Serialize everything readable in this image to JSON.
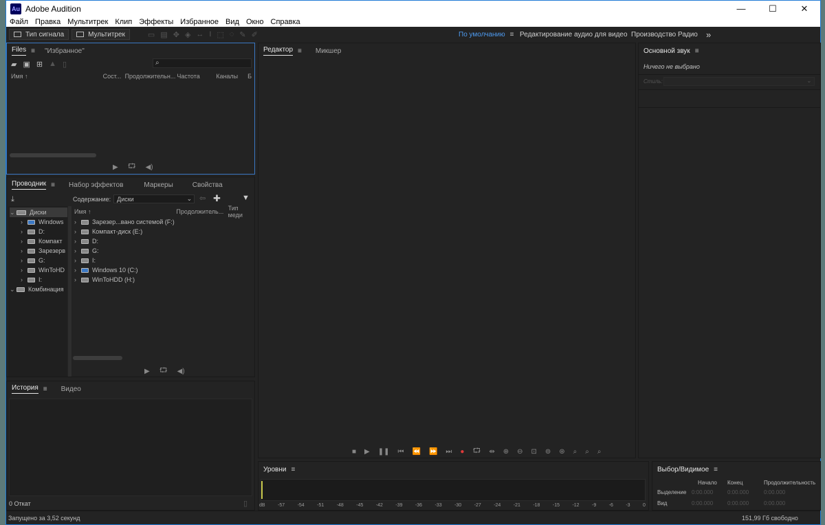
{
  "window": {
    "title": "Adobe Audition",
    "app_icon_text": "Au",
    "minimize": "—",
    "maximize": "☐",
    "close": "✕"
  },
  "menu": [
    "Файл",
    "Правка",
    "Мультитрек",
    "Клип",
    "Эффекты",
    "Избранное",
    "Вид",
    "Окно",
    "Справка"
  ],
  "toolbar": {
    "waveform_label": "Тип сигнала",
    "multitrack_label": "Мультитрек"
  },
  "workspaces": {
    "default": "По умолчанию",
    "video": "Редактирование аудио для видео",
    "radio": "Производство Радио",
    "more": "»"
  },
  "files_panel": {
    "tab_files": "Files",
    "tab_favorites": "\"Избранное\"",
    "search_icon": "⌕",
    "columns": [
      "Имя ↑",
      "Сост...",
      "Продолжительн...",
      "Частота",
      "Каналы",
      "Б"
    ]
  },
  "explorer_panel": {
    "tabs": [
      "Проводник",
      "Набор эффектов",
      "Маркеры",
      "Свойства"
    ],
    "content_label": "Содержание:",
    "content_value": "Диски",
    "tree": [
      {
        "label": "Диски",
        "chev": "⌄",
        "indent": 0
      },
      {
        "label": "Windows",
        "chev": "›",
        "indent": 1
      },
      {
        "label": "D:",
        "chev": "›",
        "indent": 1
      },
      {
        "label": "Компакт",
        "chev": "›",
        "indent": 1
      },
      {
        "label": "Зарезерв",
        "chev": "›",
        "indent": 1
      },
      {
        "label": "G:",
        "chev": "›",
        "indent": 1
      },
      {
        "label": "WinToHD",
        "chev": "›",
        "indent": 1
      },
      {
        "label": "I:",
        "chev": "›",
        "indent": 1
      },
      {
        "label": "Комбинация",
        "chev": "⌄",
        "indent": 0
      }
    ],
    "list_columns": [
      "Имя ↑",
      "Продолжитель...",
      "Тип меди"
    ],
    "list": [
      "Зарезер...вано системой (F:)",
      "Компакт-диск (E:)",
      "D:",
      "G:",
      "I:",
      "Windows 10 (C:)",
      "WinToHDD (H:)"
    ]
  },
  "history_panel": {
    "tabs": [
      "История",
      "Видео"
    ],
    "undo_count": "0 Откат"
  },
  "editor_panel": {
    "tabs": [
      "Редактор",
      "Микшер"
    ]
  },
  "essential_sound": {
    "tab": "Основной звук",
    "nothing_selected": "Ничего не выбрано",
    "style_label": "Стиль:"
  },
  "levels_panel": {
    "tab": "Уровни",
    "scale": [
      "dB",
      "-57",
      "-54",
      "-51",
      "-48",
      "-45",
      "-42",
      "-39",
      "-36",
      "-33",
      "-30",
      "-27",
      "-24",
      "-21",
      "-18",
      "-15",
      "-12",
      "-9",
      "-6",
      "-3",
      "0"
    ]
  },
  "selection_panel": {
    "tab": "Выбор/Видимое",
    "headers": [
      "Начало",
      "Конец",
      "Продолжительность"
    ],
    "rows": [
      {
        "label": "Выделение",
        "values": [
          "0:00.000",
          "0:00.000",
          "0:00.000"
        ]
      },
      {
        "label": "Вид",
        "values": [
          "0:00.000",
          "0:00.000",
          "0:00.000"
        ]
      }
    ]
  },
  "status": {
    "launched": "Запущено за 3,52 секунд",
    "free_space": "151,99 Гб свободно"
  },
  "colors": {
    "accent": "#3b78c4",
    "record": "#e03a3a",
    "panel_bg": "#232323"
  }
}
